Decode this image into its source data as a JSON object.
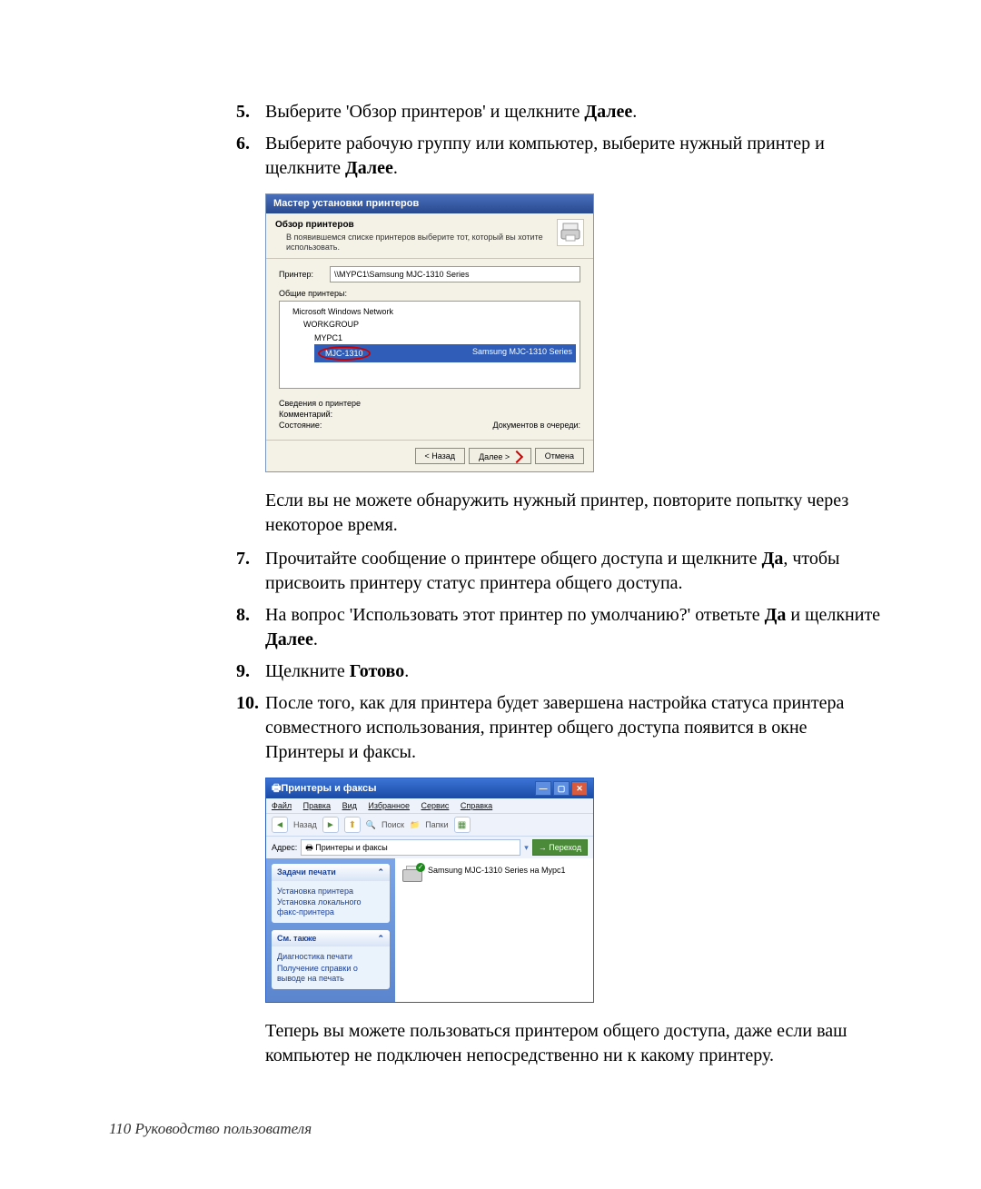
{
  "steps": {
    "s5": {
      "num": "5.",
      "a": "Выберите 'Обзор принтеров' и щелкните ",
      "b": "Далее",
      "c": "."
    },
    "s6": {
      "num": "6.",
      "a": "Выберите рабочую группу или компьютер, выберите нужный принтер и щелкните ",
      "b": "Далее",
      "c": "."
    },
    "note1": "Если вы не можете обнаружить нужный принтер, повторите попытку через некоторое время.",
    "s7": {
      "num": "7.",
      "a": "Прочитайте сообщение о принтере общего доступа и щелкните ",
      "b": "Да",
      "c": ", чтобы присвоить принтеру статус принтера общего доступа."
    },
    "s8": {
      "num": "8.",
      "a": "На вопрос 'Использовать этот принтер по умолчанию?' ответьте ",
      "b": "Да",
      "c": " и щелкните ",
      "d": "Далее",
      "e": "."
    },
    "s9": {
      "num": "9.",
      "a": "Щелкните ",
      "b": "Готово",
      "c": "."
    },
    "s10": {
      "num": "10.",
      "a": "После того, как для принтера будет завершена настройка статуса принтера совместного использования, принтер общего доступа появится в окне Принтеры и факсы."
    },
    "note2": "Теперь вы можете пользоваться принтером общего доступа, даже если ваш компьютер не подключен непосредственно ни к какому принтеру."
  },
  "wizard": {
    "title": "Мастер установки принтеров",
    "head_title": "Обзор принтеров",
    "head_sub": "В появившемся списке принтеров выберите тот, который вы хотите использовать.",
    "printer_label": "Принтер:",
    "printer_value": "\\\\MYPC1\\Samsung MJC-1310 Series",
    "shared_label": "Общие принтеры:",
    "tree": {
      "root": "Microsoft Windows Network",
      "wg": "WORKGROUP",
      "pc": "MYPC1",
      "sel_name": "MJC-1310",
      "sel_desc": "Samsung MJC-1310 Series"
    },
    "info_title": "Сведения о принтере",
    "info_comment": "Комментарий:",
    "info_status_l": "Состояние:",
    "info_status_r": "Документов в очереди:",
    "btn_back": "< Назад",
    "btn_next": "Далее >",
    "btn_cancel": "Отмена"
  },
  "win": {
    "title": "Принтеры и факсы",
    "menu": [
      "Файл",
      "Правка",
      "Вид",
      "Избранное",
      "Сервис",
      "Справка"
    ],
    "tb_back": "Назад",
    "tb_search": "Поиск",
    "tb_folders": "Папки",
    "addr_label": "Адрес:",
    "addr_value": "Принтеры и факсы",
    "go": "Переход",
    "panel1_title": "Задачи печати",
    "panel1_items": [
      "Установка принтера",
      "Установка локального факс-принтера"
    ],
    "panel2_title": "См. также",
    "panel2_items": [
      "Диагностика печати",
      "Получение справки о выводе на печать"
    ],
    "printer_name": "Samsung MJC-1310 Series на Mypc1"
  },
  "footer": "110  Руководство пользователя"
}
